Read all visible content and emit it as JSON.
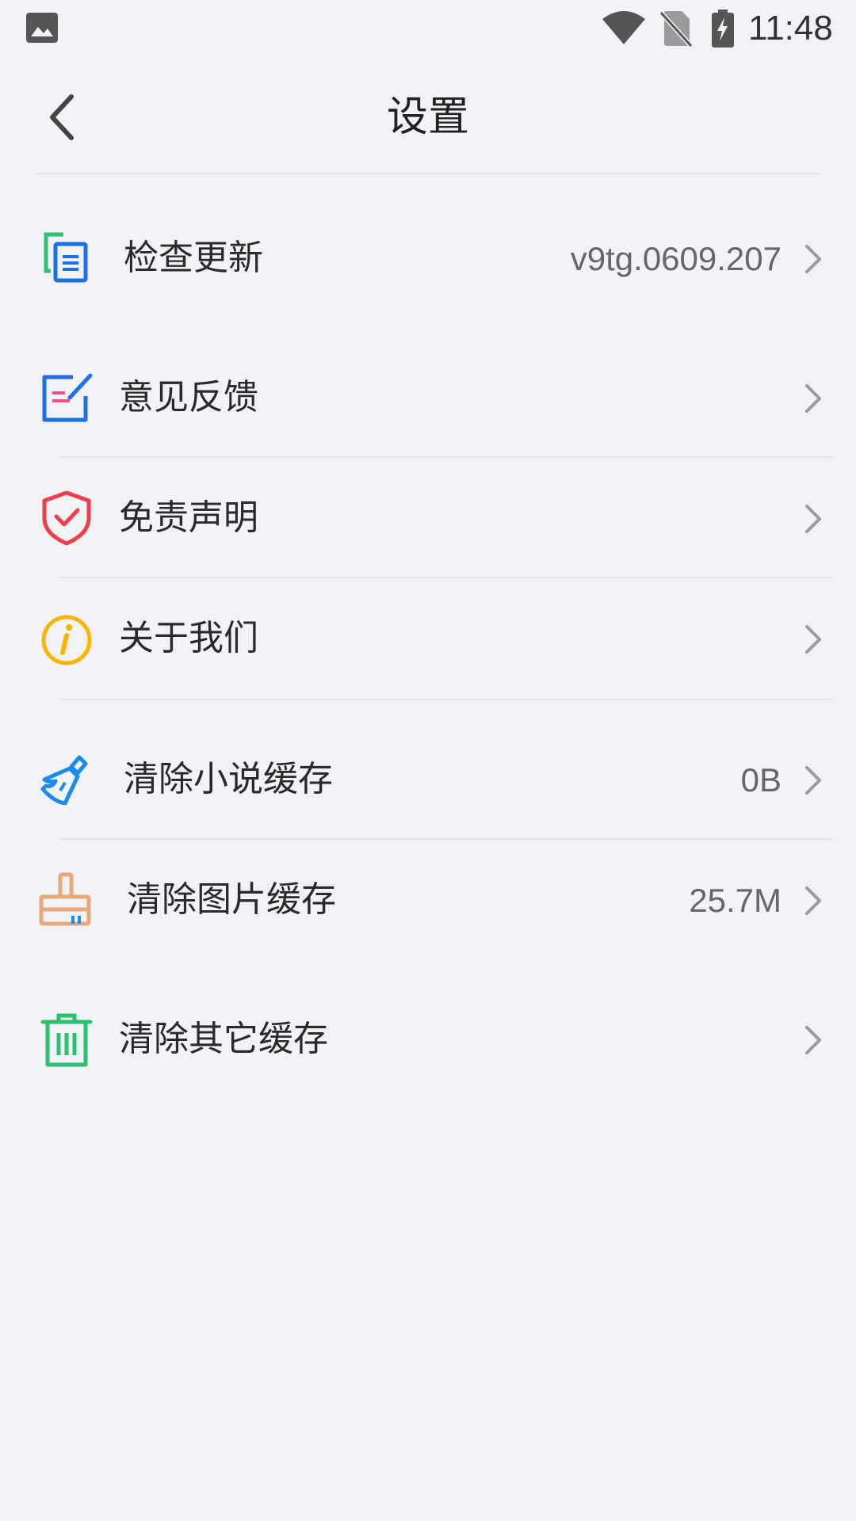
{
  "status_bar": {
    "time": "11:48",
    "icons": [
      "gallery-icon",
      "wifi-icon",
      "no-sim-icon",
      "battery-charging-icon"
    ]
  },
  "header": {
    "title": "设置",
    "back_icon": "chevron-left-icon"
  },
  "settings": [
    {
      "id": "check-update",
      "label": "检查更新",
      "value": "v9tg.0609.207",
      "icon": "document-copy-icon"
    },
    {
      "id": "feedback",
      "label": "意见反馈",
      "value": "",
      "icon": "edit-note-icon"
    },
    {
      "id": "disclaimer",
      "label": "免责声明",
      "value": "",
      "icon": "shield-check-icon"
    },
    {
      "id": "about-us",
      "label": "关于我们",
      "value": "",
      "icon": "info-icon"
    },
    {
      "id": "clear-novel-cache",
      "label": "清除小说缓存",
      "value": "0B",
      "icon": "broom-icon"
    },
    {
      "id": "clear-image-cache",
      "label": "清除图片缓存",
      "value": "25.7M",
      "icon": "brush-icon"
    },
    {
      "id": "clear-other-cache",
      "label": "清除其它缓存",
      "value": "",
      "icon": "trash-icon"
    }
  ],
  "colors": {
    "background": "#f1f2f5",
    "text": "#2a2a2a",
    "value_text": "#666666",
    "chevron": "#9a9a9a",
    "divider": "#e4e5e8",
    "update_green": "#2fbf71",
    "update_blue": "#1f6fe5",
    "feedback_blue": "#1f6fe5",
    "feedback_pink": "#f0508c",
    "shield_red": "#ef3f4f",
    "info_yellow": "#f7b500",
    "broom_blue": "#1a8cf0",
    "brush_orange": "#e8a87a",
    "trash_green": "#2fbf71"
  }
}
